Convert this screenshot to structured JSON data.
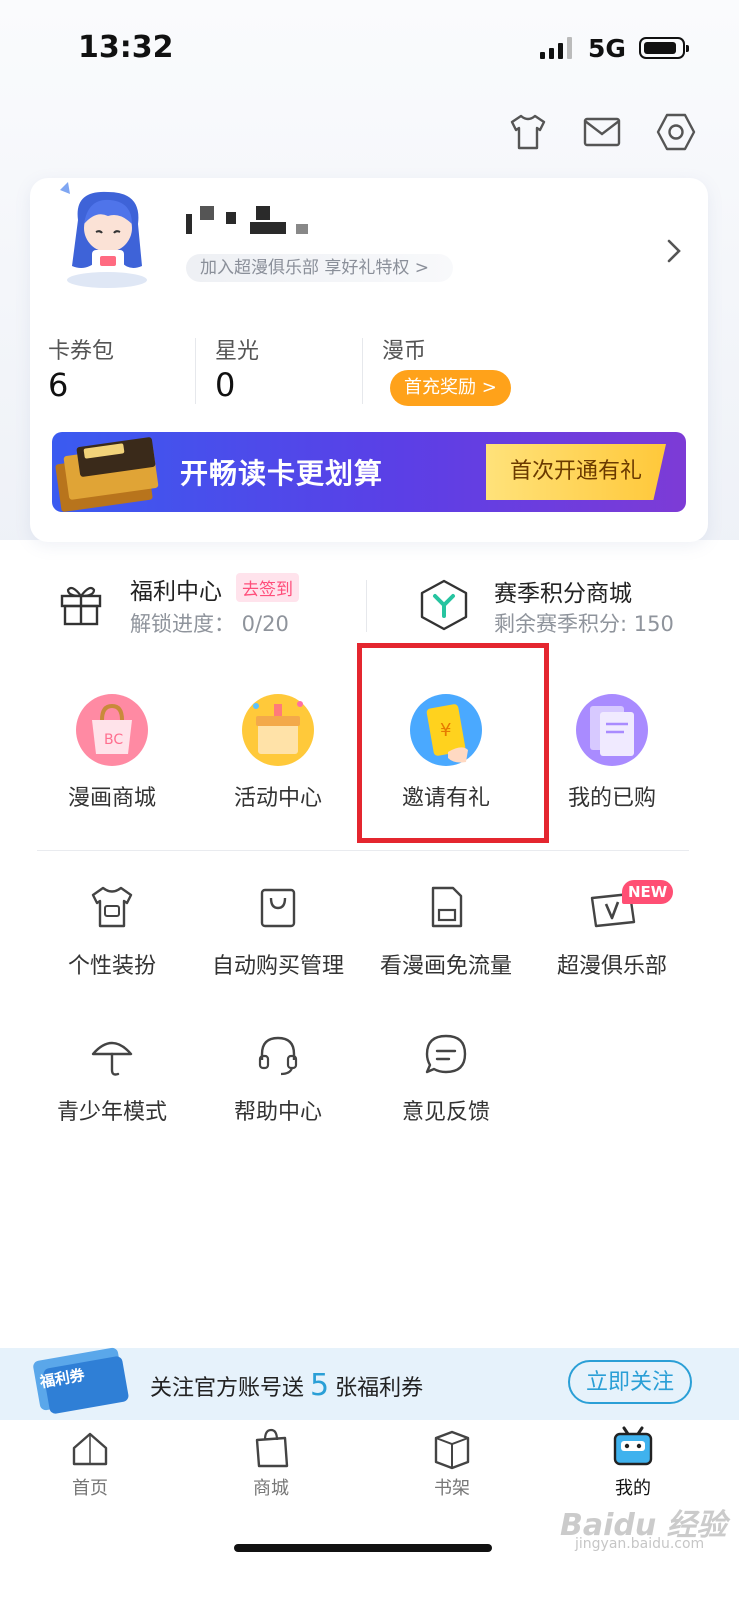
{
  "status_bar": {
    "time": "13:32",
    "network": "5G"
  },
  "header_icons": [
    "tshirt-icon",
    "mail-icon",
    "settings-icon"
  ],
  "profile": {
    "club_tag": "加入超漫俱乐部 享好礼特权 >",
    "stats": [
      {
        "label": "卡券包",
        "value": "6"
      },
      {
        "label": "星光",
        "value": "0"
      },
      {
        "label": "漫币",
        "badge": "首充奖励 >"
      }
    ],
    "vip_banner": {
      "text": "开畅读卡更划算",
      "button": "首次开通有礼"
    }
  },
  "welfare": {
    "left": {
      "title": "福利中心",
      "badge": "去签到",
      "sub": "解锁进度：  0/20"
    },
    "right": {
      "title": "赛季积分商城",
      "sub": "剩余赛季积分: 150"
    }
  },
  "featured_grid": [
    {
      "label": "漫画商城",
      "icon": "shopping-bag-icon"
    },
    {
      "label": "活动中心",
      "icon": "gift-box-icon"
    },
    {
      "label": "邀请有礼",
      "icon": "red-envelope-icon"
    },
    {
      "label": "我的已购",
      "icon": "books-icon"
    }
  ],
  "tools_grid": [
    {
      "label": "个性装扮",
      "icon": "tshirt-icon"
    },
    {
      "label": "自动购买管理",
      "icon": "shopping-bag-outline-icon"
    },
    {
      "label": "看漫画免流量",
      "icon": "sim-card-icon"
    },
    {
      "label": "超漫俱乐部",
      "icon": "vip-card-icon",
      "badge": "NEW"
    },
    {
      "label": "青少年模式",
      "icon": "umbrella-icon"
    },
    {
      "label": "帮助中心",
      "icon": "headset-icon"
    },
    {
      "label": "意见反馈",
      "icon": "feedback-icon"
    }
  ],
  "follow_bar": {
    "coupon_label": "福利券",
    "text_before": "关注官方账号送",
    "count": "5",
    "text_after": "张福利券",
    "button": "立即关注"
  },
  "tabs": [
    {
      "label": "首页",
      "icon": "home-icon"
    },
    {
      "label": "商城",
      "icon": "shop-icon"
    },
    {
      "label": "书架",
      "icon": "bookshelf-icon"
    },
    {
      "label": "我的",
      "icon": "profile-robot-icon"
    }
  ],
  "watermark": {
    "main": "Baidu 经验",
    "sub": "jingyan.baidu.com"
  },
  "colors": {
    "accent_blue": "#2a9fd6",
    "orange": "#ffa21a",
    "highlight_red": "#e4262f",
    "pink": "#ff4e7a"
  }
}
